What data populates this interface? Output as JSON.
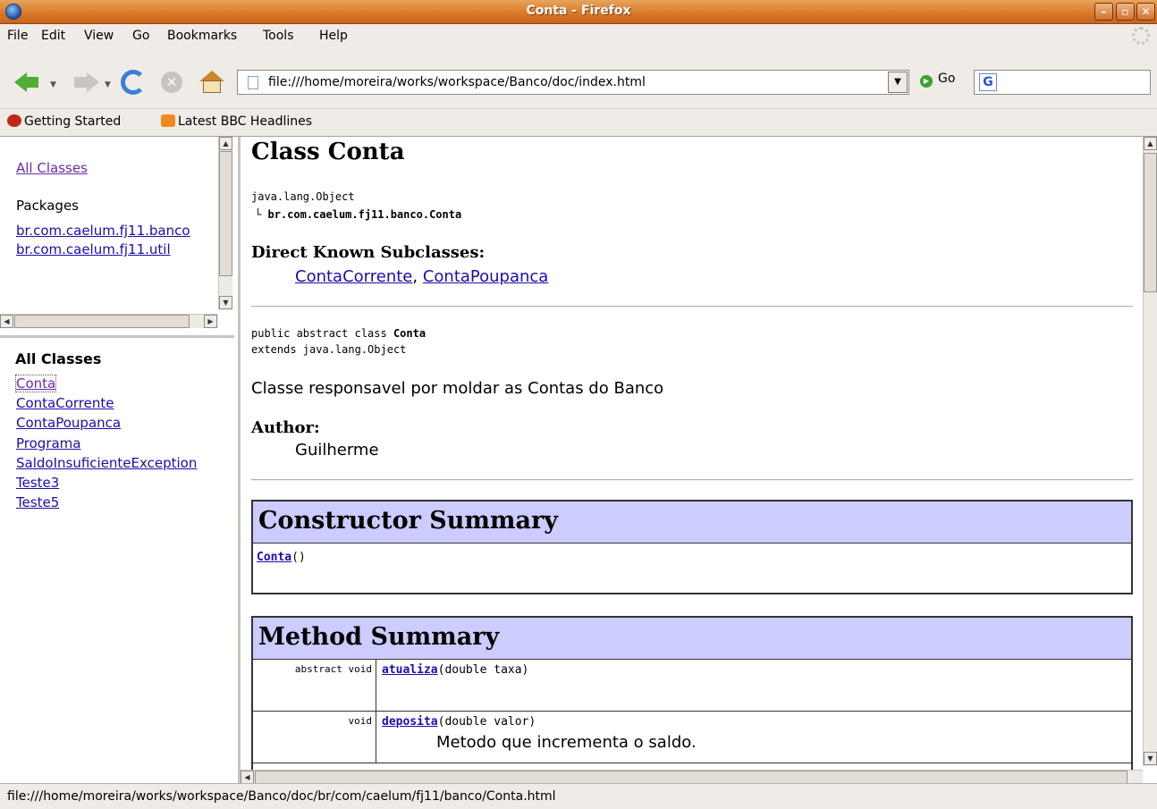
{
  "window": {
    "title": "Conta - Firefox",
    "min": "–",
    "max": "▫",
    "close": "✕"
  },
  "menu": [
    "File",
    "Edit",
    "View",
    "Go",
    "Bookmarks",
    "Tools",
    "Help"
  ],
  "nav": {
    "url": "file:///home/moreira/works/workspace/Banco/doc/index.html",
    "go_label": "Go",
    "search_value": ""
  },
  "bookmarks": [
    "Getting Started",
    "Latest BBC Headlines"
  ],
  "packages_frame": {
    "all_classes": "All Classes",
    "heading": "Packages",
    "packages": [
      "br.com.caelum.fj11.banco",
      "br.com.caelum.fj11.util"
    ]
  },
  "classes_frame": {
    "heading": "All Classes",
    "classes": [
      "Conta",
      "ContaCorrente",
      "ContaPoupanca",
      "Programa",
      "SaldoInsuficienteException",
      "Teste3",
      "Teste5"
    ]
  },
  "main": {
    "title": "Class Conta",
    "hierarchy_root": "java.lang.Object",
    "hierarchy_class": "br.com.caelum.fj11.banco.Conta",
    "subclasses_heading": "Direct Known Subclasses:",
    "subclasses": [
      "ContaCorrente",
      "ContaPoupanca"
    ],
    "decl_line1_prefix": "public abstract class ",
    "decl_line1_name": "Conta",
    "decl_line2": "extends java.lang.Object",
    "description": "Classe responsavel por moldar as Contas do Banco",
    "author_heading": "Author:",
    "author": "Guilherme",
    "constructor_heading": "Constructor Summary",
    "constructor_name": "Conta",
    "constructor_params": "()",
    "method_heading": "Method Summary",
    "methods": [
      {
        "modifiers": "abstract  void",
        "name": "atualiza",
        "params": "(double taxa)",
        "desc": ""
      },
      {
        "modifiers": "void",
        "name": "deposita",
        "params": "(double valor)",
        "desc": "Metodo que incrementa o saldo."
      }
    ]
  },
  "status": "file:///home/moreira/works/workspace/Banco/doc/br/com/caelum/fj11/banco/Conta.html"
}
